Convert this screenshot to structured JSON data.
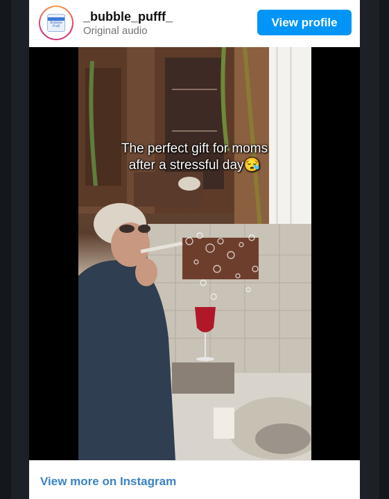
{
  "header": {
    "username": "_bubble_pufff_",
    "subtitle": "Original audio",
    "view_profile_label": "View profile",
    "avatar_logo_text": "Bubble Puff"
  },
  "video": {
    "caption_line1": "The perfect gift for moms",
    "caption_line2": "after a stressful day😪"
  },
  "footer": {
    "link_label": "View more on Instagram"
  },
  "colors": {
    "accent": "#0095f6",
    "link": "#3b82c4"
  }
}
